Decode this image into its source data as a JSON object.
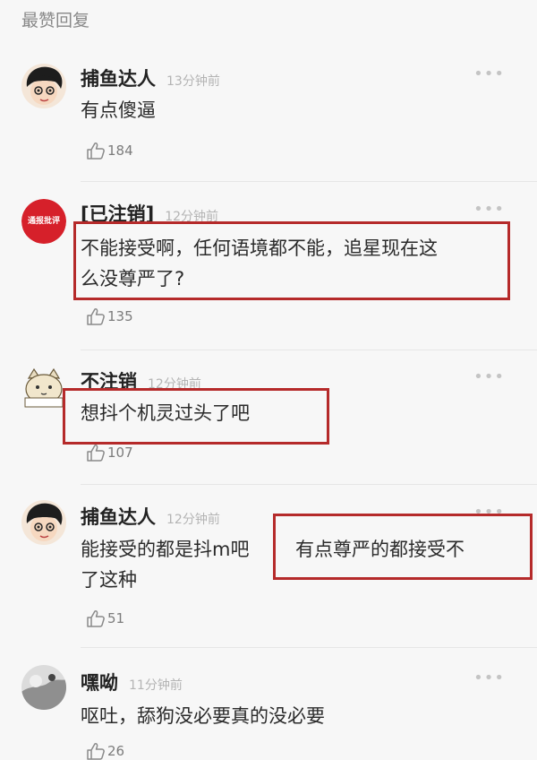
{
  "section_title": "最赞回复",
  "comments": [
    {
      "username": "捕鱼达人",
      "time": "13分钟前",
      "text_lines": [
        "有点傻逼"
      ],
      "likes": "184",
      "avatar": "cartoon-boy-avatar"
    },
    {
      "username": "[已注销]",
      "time": "12分钟前",
      "text_lines": [
        "不能接受啊，任何语境都不能，追星现在这",
        "么没尊严了?"
      ],
      "likes": "135",
      "avatar": "red-badge-avatar",
      "avatar_label": "通报批评"
    },
    {
      "username": "不注销",
      "time": "12分钟前",
      "text_lines": [
        "想抖个机灵过头了吧"
      ],
      "likes": "107",
      "avatar": "cartoon-cat-avatar"
    },
    {
      "username": "捕鱼达人",
      "time": "12分钟前",
      "text_lines": [
        "能接受的都是抖m吧",
        "了这种"
      ],
      "text_inline_continuation": "有点尊严的都接受不",
      "likes": "51",
      "avatar": "cartoon-boy-avatar"
    },
    {
      "username": "嘿呦",
      "time": "11分钟前",
      "text_lines": [
        "呕吐，舔狗没必要真的没必要"
      ],
      "likes": "26",
      "avatar": "photo-avatar"
    }
  ],
  "icons": {
    "like": "thumbs-up-outline-icon",
    "more": "more-dots-icon"
  },
  "colors": {
    "highlight_box": "#b52a2a",
    "badge_red": "#d6202a"
  }
}
